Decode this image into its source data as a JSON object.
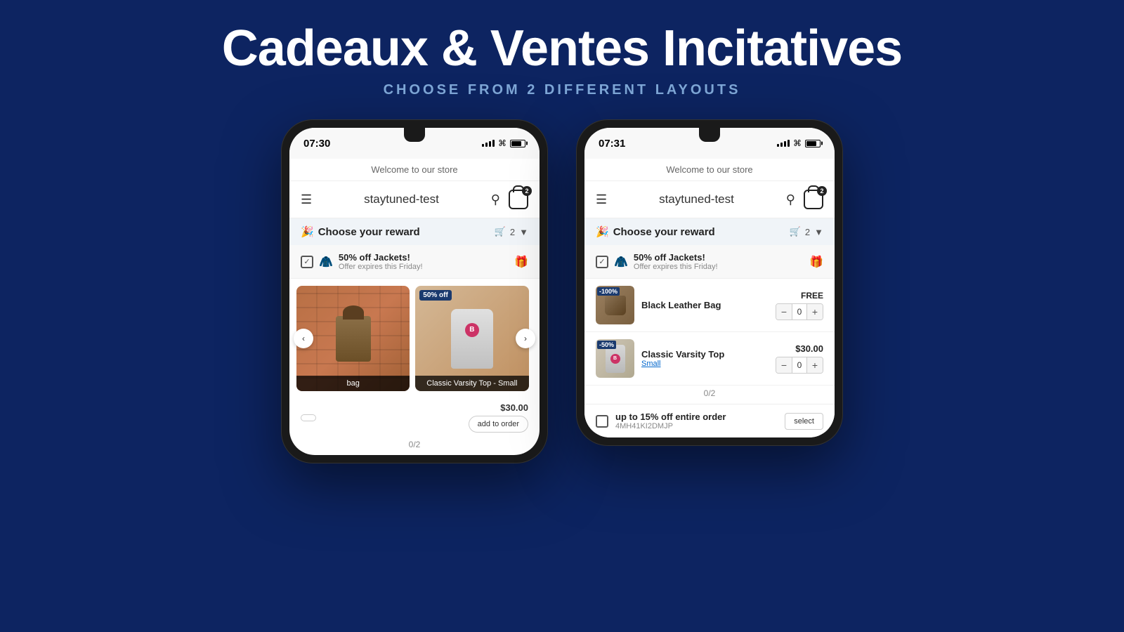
{
  "page": {
    "background_color": "#0d2461",
    "main_title": "Cadeaux & Ventes Incitatives",
    "subtitle": "CHOOSE FROM 2 DIFFERENT LAYOUTS"
  },
  "phone1": {
    "time": "07:30",
    "store_welcome": "Welcome to our store",
    "store_name": "staytuned-test",
    "cart_count": "2",
    "reward_label": "Choose your reward",
    "reward_cart_count": "2",
    "offer_title": "50% off Jackets!",
    "offer_subtitle": "Offer expires this Friday!",
    "product1_label": "bag",
    "product2_label": "Classic Varsity Top - Small",
    "product2_badge": "50% off",
    "product2_price": "$30.00",
    "add_to_order": "add to order",
    "progress": "0/2"
  },
  "phone2": {
    "time": "07:31",
    "store_welcome": "Welcome to our store",
    "store_name": "staytuned-test",
    "cart_count": "2",
    "reward_label": "Choose your reward",
    "reward_cart_count": "2",
    "offer_title": "50% off Jackets!",
    "offer_subtitle": "Offer expires this Friday!",
    "product1_name": "Black Leather Bag",
    "product1_price": "FREE",
    "product1_badge": "-100%",
    "product1_qty": "0",
    "product2_name": "Classic Varsity Top",
    "product2_variant": "Small",
    "product2_price": "$30.00",
    "product2_badge": "-50%",
    "product2_qty": "0",
    "progress": "0/2",
    "offer2_title": "up to 15% off entire order",
    "offer2_code": "4MH41KI2DMJP",
    "select_btn": "select"
  }
}
